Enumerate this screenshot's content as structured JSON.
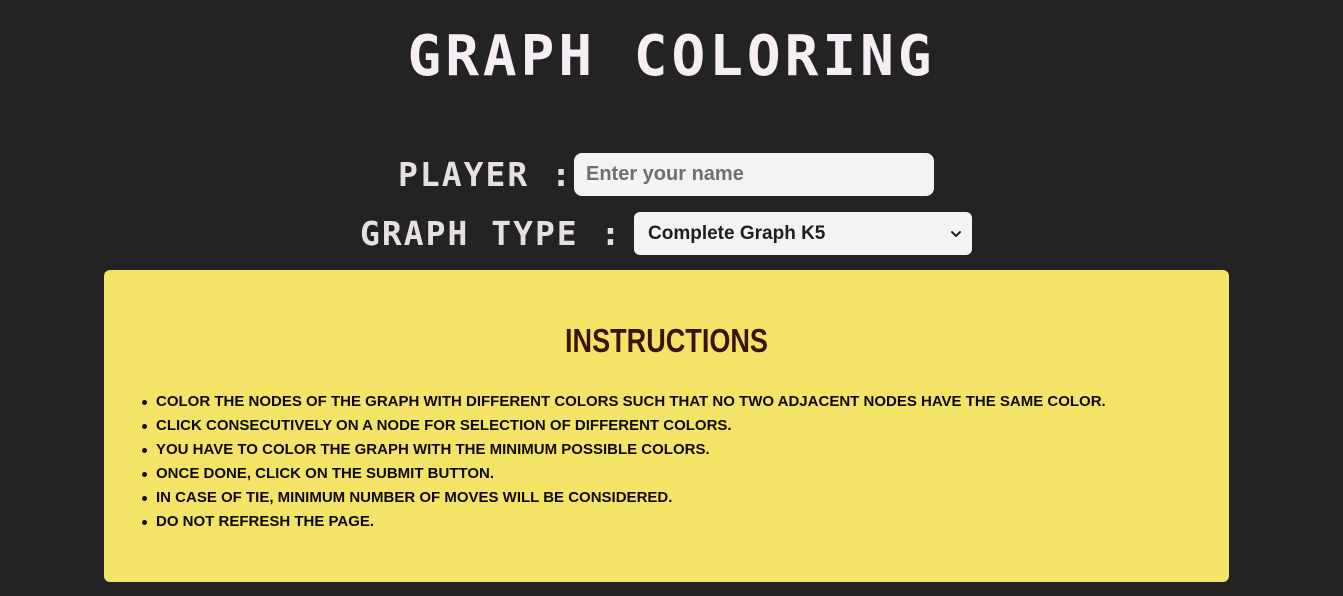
{
  "header": {
    "title": "Graph Coloring"
  },
  "form": {
    "player_label": "Player :",
    "player_placeholder": "Enter your name",
    "player_value": "",
    "graph_type_label": "Graph Type :",
    "graph_type_selected": "Complete Graph K5"
  },
  "instructions": {
    "title": "Instructions",
    "items": [
      "Color the nodes of the graph with different colors such that no two adjacent nodes have the same color.",
      "Click consecutively on a node for selection of different colors.",
      "You have to color the graph with the minimum possible colors.",
      "Once done, click on the submit button.",
      "In case of tie, minimum number of moves will be considered.",
      "Do not refresh the page."
    ]
  },
  "colors": {
    "background": "#232323",
    "panel": "#f3e467",
    "instructions_title": "#3d1108",
    "heading_text": "#f6eef4"
  },
  "icons": {
    "select_arrow": "chevron-down-icon"
  }
}
